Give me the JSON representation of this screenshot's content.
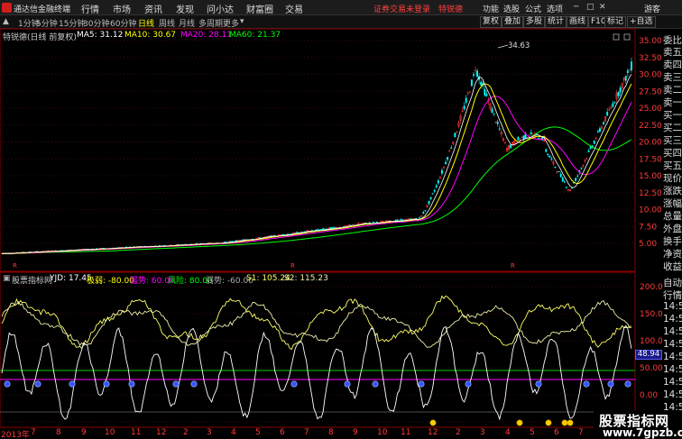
{
  "app": {
    "title": "通达信金融终端"
  },
  "menu": [
    "行情",
    "市场",
    "资讯",
    "发现",
    "问小达",
    "财富圈",
    "交易"
  ],
  "notice": "证券交易未登录　特锐德",
  "top_right_menu": [
    "功能",
    "选股",
    "公式",
    "选项"
  ],
  "window_controls": {
    "user": "游客"
  },
  "periods": [
    "1分钟",
    "5分钟",
    "15分钟",
    "30分钟",
    "60分钟",
    "日线",
    "周线",
    "月线",
    "多周期",
    "更多"
  ],
  "active_period": "日线",
  "toolbar_right": [
    "复权",
    "叠加",
    "多股",
    "统计",
    "画线",
    "F10",
    "标记",
    "+自选"
  ],
  "ma_row": {
    "stock_label": "特锐德(日线 前复权)",
    "ma5": "MA5: 31.12",
    "ma10": "MA10: 30.67",
    "ma20": "MA20: 28.11",
    "ma60": "MA60: 21.37"
  },
  "indicator_row": {
    "name": "股票指标网",
    "yjd": "YJD: 17.45",
    "jd": "极弱: -80.00",
    "qs": "强势: 60.00",
    "fx": "风险: 80.00",
    "rs": "弱势: -60.00",
    "s1": "S1: 105.24",
    "s2": "S2: 115.23"
  },
  "price_axis": [
    "35.00",
    "32.50",
    "30.00",
    "27.50",
    "25.00",
    "22.50",
    "20.00",
    "17.50",
    "15.00",
    "12.50",
    "10.00",
    "7.50",
    "5.00"
  ],
  "peak_label": "34.63",
  "indicator_axis": [
    "200.0",
    "150.0",
    "100.0",
    "50.00",
    "0.00",
    "-50.00"
  ],
  "price_tag": "48.94",
  "sidebar_items": [
    "委比",
    "卖五",
    "卖四",
    "卖三",
    "卖二",
    "卖一",
    "买一",
    "买二",
    "买三",
    "买四",
    "买五",
    "现价",
    "涨跌",
    "涨幅",
    "总量",
    "外盘",
    "换手",
    "净资",
    "收益",
    "自动",
    "行情",
    "14:5",
    "14:5",
    "14:5",
    "14:5",
    "14:5",
    "14:5",
    "14:5",
    "14:5",
    "14:5",
    "14:5",
    "14:5"
  ],
  "year_label": "2013年",
  "months": [
    "7",
    "8",
    "9",
    "10",
    "11",
    "12",
    "2",
    "3",
    "4",
    "5",
    "6",
    "7",
    "8",
    "9",
    "10",
    "11",
    "12",
    "2",
    "3",
    "4",
    "5",
    "6",
    "7",
    "8",
    "9"
  ],
  "watermark": {
    "line1": "股票指标网",
    "line2": "www.7gpzb.com"
  },
  "colors": {
    "ma5": "#ffffff",
    "ma10": "#ffff00",
    "ma20": "#ff00ff",
    "ma60": "#00ff00",
    "up": "#ff3c3c",
    "down": "#00ffff",
    "axis": "#ff3c3c"
  }
}
